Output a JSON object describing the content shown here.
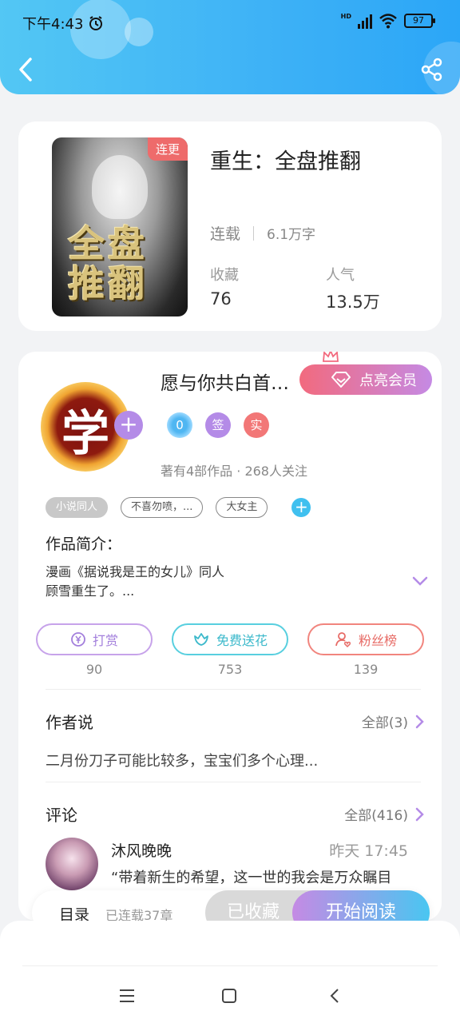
{
  "status_bar": {
    "time": "下午4:43",
    "network": "HD",
    "battery": "97"
  },
  "book": {
    "cover_tag": "连更",
    "cover_title_line1": "全盘",
    "cover_title_line2": "推翻",
    "title": "重生：全盘推翻",
    "status": "连载",
    "word_count": "6.1万字",
    "favorites_label": "收藏",
    "favorites_value": "76",
    "popularity_label": "人气",
    "popularity_value": "13.5万"
  },
  "author": {
    "avatar_char": "学",
    "name": "愿与你共白首…",
    "vip_button": "点亮会员",
    "badges": {
      "level": "0",
      "sign": "签",
      "real": "实"
    },
    "stats": "著有4部作品 · 268人关注"
  },
  "tags": [
    "小说同人",
    "不喜勿喷，...",
    "大女主"
  ],
  "intro": {
    "title": "作品简介：",
    "line1": "漫画《据说我是王的女儿》同人",
    "line2": "顾雪重生了。..."
  },
  "actions": [
    {
      "label": "打赏",
      "count": "90"
    },
    {
      "label": "免费送花",
      "count": "753"
    },
    {
      "label": "粉丝榜",
      "count": "139"
    }
  ],
  "author_says": {
    "title": "作者说",
    "more": "全部(3)",
    "text": "二月份刀子可能比较多，宝宝们多个心理..."
  },
  "comments": {
    "title": "评论",
    "more": "全部(416)",
    "first": {
      "name": "沐风晚晚",
      "time": "昨天 17:45",
      "text": "“带着新生的希望，这一世的我会是万众瞩目"
    }
  },
  "bottom_bar": {
    "toc": "目录",
    "chapters": "已连载37章",
    "collected": "已收藏",
    "read": "开始阅读"
  }
}
